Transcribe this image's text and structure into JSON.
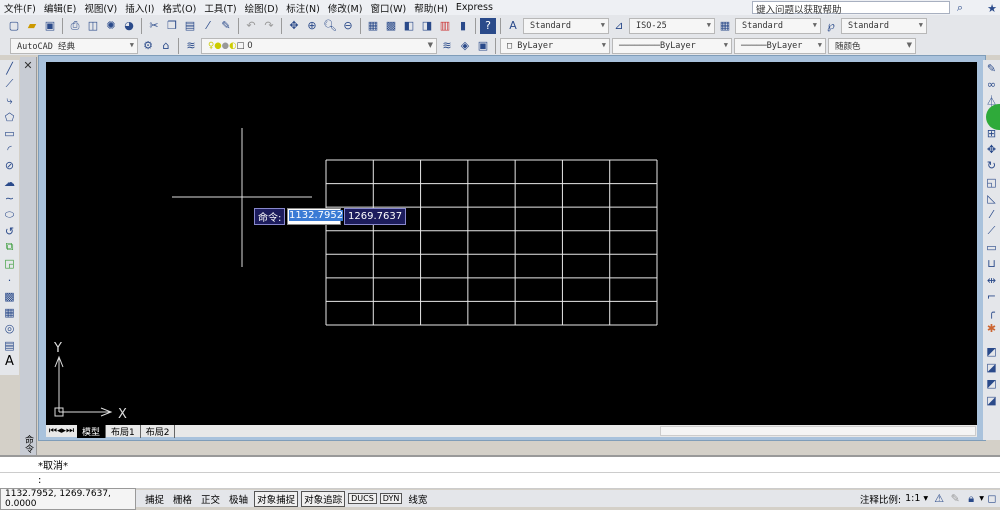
{
  "menu": [
    "文件(F)",
    "编辑(E)",
    "视图(V)",
    "插入(I)",
    "格式(O)",
    "工具(T)",
    "绘图(D)",
    "标注(N)",
    "修改(M)",
    "窗口(W)",
    "帮助(H)",
    "Express"
  ],
  "help_placeholder": "键入问题以获取帮助",
  "styles": {
    "text_style": "Standard",
    "dim_style": "ISO-25",
    "table_style": "Standard",
    "mleader_style": "Standard"
  },
  "workspace": "AutoCAD 经典",
  "layer": "0",
  "properties": {
    "color": "ByLayer",
    "linetype": "ByLayer",
    "lineweight": "ByLayer",
    "plotstyle": "随颜色"
  },
  "canvas": {
    "background": "#000000",
    "table_rows": 7,
    "table_cols": 7,
    "ucs_x": "X",
    "ucs_y": "Y"
  },
  "dynamic_input": {
    "prompt": "命令:",
    "x_value": "1132.7952",
    "y_value": "1269.7637"
  },
  "tabs": [
    "模型",
    "布局1",
    "布局2"
  ],
  "command": {
    "history": "*取消*",
    "prompt": ":"
  },
  "status": {
    "coords": "1132.7952, 1269.7637, 0.0000",
    "toggles": [
      {
        "label": "捕捉",
        "on": false
      },
      {
        "label": "栅格",
        "on": false
      },
      {
        "label": "正交",
        "on": false
      },
      {
        "label": "极轴",
        "on": false
      },
      {
        "label": "对象捕捉",
        "on": true
      },
      {
        "label": "对象追踪",
        "on": true
      },
      {
        "label": "DUCS",
        "on": true
      },
      {
        "label": "DYN",
        "on": true
      },
      {
        "label": "线宽",
        "on": false
      }
    ],
    "annotation_scale_label": "注释比例:",
    "annotation_scale": "1:1"
  },
  "palette_label": "命令"
}
